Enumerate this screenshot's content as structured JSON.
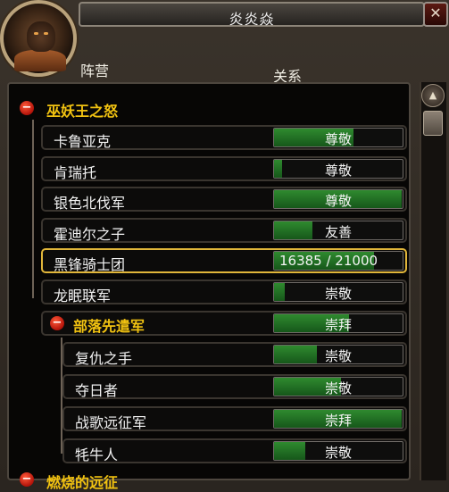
{
  "window": {
    "title": "炎炎焱",
    "close_label": "✕"
  },
  "columns": {
    "faction": "阵营",
    "relation": "关系"
  },
  "scroll": {
    "up_label": "▲"
  },
  "groups": {
    "wrath": {
      "label": "巫妖王之怒",
      "toggle": "−"
    },
    "horde": {
      "label": "部落先遣军",
      "toggle": "−",
      "standing": "崇拜",
      "fill": 0.58
    },
    "burning": {
      "label": "燃烧的远征",
      "toggle": "−"
    }
  },
  "factions": [
    {
      "name": "卡鲁亚克",
      "standing": "尊敬",
      "fill": 0.62
    },
    {
      "name": "肯瑞托",
      "standing": "尊敬",
      "fill": 0.06
    },
    {
      "name": "银色北伐军",
      "standing": "尊敬",
      "fill": 0.99
    },
    {
      "name": "霍迪尔之子",
      "standing": "友善",
      "fill": 0.3
    },
    {
      "name": "黑锋骑士团",
      "standing": "16385 / 21000",
      "fill": 0.78,
      "selected": true
    },
    {
      "name": "龙眠联军",
      "standing": "崇敬",
      "fill": 0.08
    }
  ],
  "horde_factions": [
    {
      "name": "复仇之手",
      "standing": "崇敬",
      "fill": 0.33
    },
    {
      "name": "夺日者",
      "standing": "崇敬",
      "fill": 0.52
    },
    {
      "name": "战歌远征军",
      "standing": "崇拜",
      "fill": 0.99
    },
    {
      "name": "牦牛人",
      "standing": "崇敬",
      "fill": 0.24
    }
  ]
}
